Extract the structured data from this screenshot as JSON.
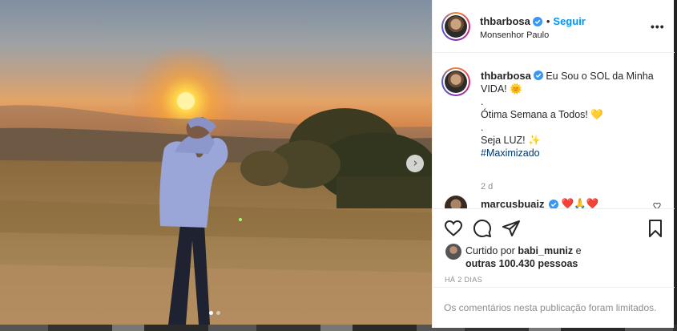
{
  "post": {
    "carousel": {
      "slide_count": 2,
      "active_slide": 1
    }
  },
  "header": {
    "username": "thbarbosa",
    "separator": "•",
    "follow_label": "Seguir",
    "location": "Monsenhor Paulo",
    "more_label": "•••"
  },
  "caption": {
    "username": "thbarbosa",
    "line1": "Eu Sou o SOL da Minha VIDA! 🌞",
    "line2": ".",
    "line3": "Ótima Semana a Todos! 💛",
    "line4": ".",
    "line5": "Seja LUZ! ✨",
    "hashtag": "#Maximizado",
    "time": "2 d"
  },
  "comment": {
    "username": "marcusbuaiz",
    "emojis": "❤️🙏❤️"
  },
  "likes": {
    "prefix": "Curtido por",
    "user": "babi_muniz",
    "conj": "e",
    "others": "outras 100.430 pessoas"
  },
  "timeago": "HÁ 2 DIAS",
  "comments_limited": "Os comentários nesta publicação foram limitados.",
  "colors": {
    "accent": "#0095f6",
    "verified": "#3897f0",
    "hashtag": "#00376b",
    "muted": "#8e8e8e"
  }
}
